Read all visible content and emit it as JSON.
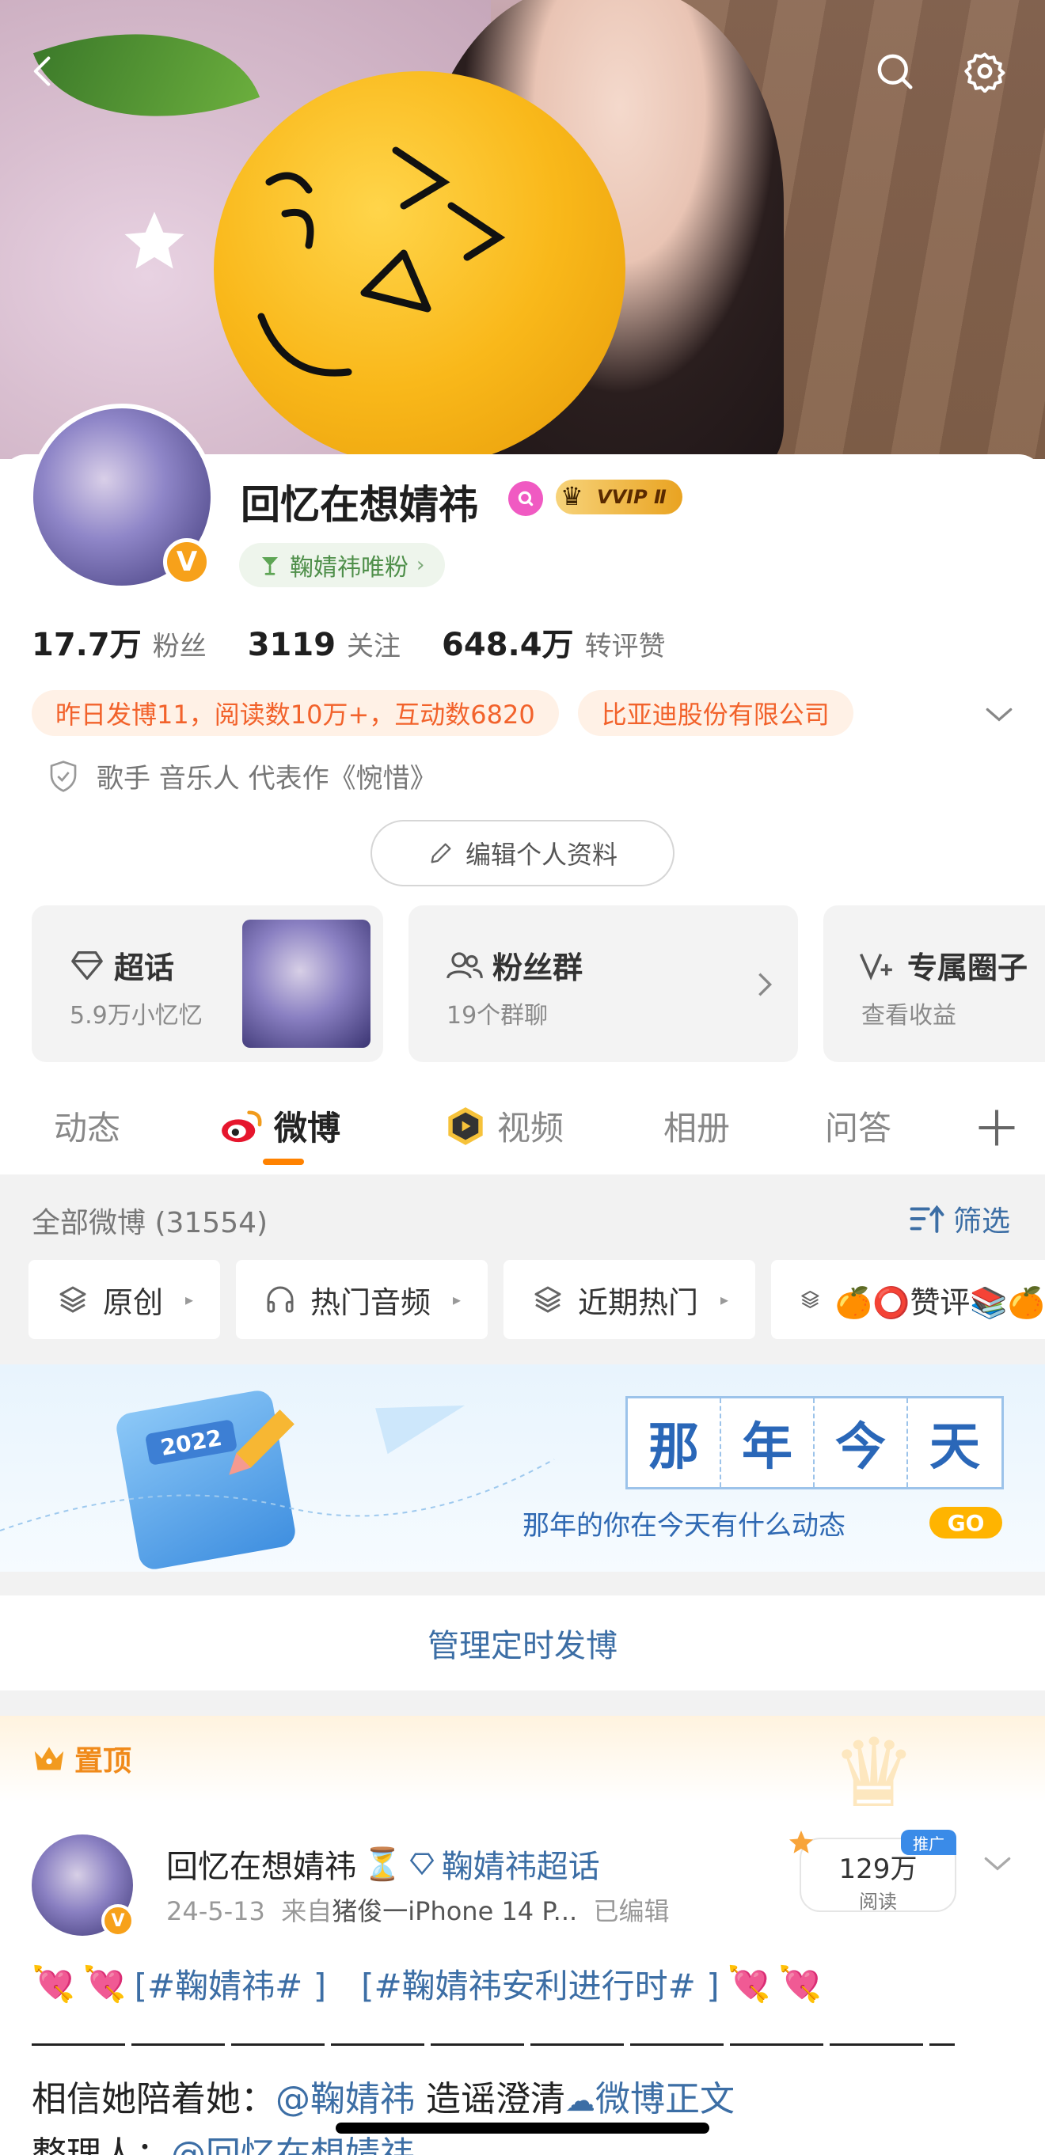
{
  "profile": {
    "name": "回忆在想婧祎",
    "vip_label": "VVIP Ⅱ",
    "fan_tag": "鞠婧祎唯粉",
    "verified_badge": "V",
    "stats": [
      {
        "value": "17.7万",
        "label": "粉丝"
      },
      {
        "value": "3119",
        "label": "关注"
      },
      {
        "value": "648.4万",
        "label": "转评赞"
      }
    ],
    "tags": [
      "昨日发博11，阅读数10万+，互动数6820",
      "比亚迪股份有限公司"
    ],
    "bio": "歌手 音乐人 代表作《惋惜》",
    "edit_label": "编辑个人资料"
  },
  "features": [
    {
      "title": "超话",
      "subtitle": "5.9万小忆忆",
      "icon": "diamond-icon"
    },
    {
      "title": "粉丝群",
      "subtitle": "19个群聊",
      "icon": "group-icon"
    },
    {
      "title": "专属圈子",
      "subtitle": "查看收益",
      "icon": "v-plus-icon"
    }
  ],
  "tabs": [
    "动态",
    "微博",
    "视频",
    "相册",
    "问答"
  ],
  "active_tab": "微博",
  "filter": {
    "all_label": "全部微博 (31554)",
    "screen_label": "筛选",
    "chips": [
      "原创",
      "热门音频",
      "近期热门",
      "🍊⭕赞评📚🍊"
    ]
  },
  "banner": {
    "title_chars": [
      "那",
      "年",
      "今",
      "天"
    ],
    "subtitle": "那年的你在今天有什么动态",
    "go": "GO",
    "calendar_year": "2022"
  },
  "scheduled_label": "管理定时发博",
  "pinned_label": "置顶",
  "post": {
    "author": "回忆在想婧祎",
    "hourglass": "⏳",
    "topic": "鞠婧祎超话",
    "date": "24-5-13",
    "source_prefix": "来自",
    "device": "猪俊一iPhone 14 P...",
    "edited": "已编辑",
    "reads": "129万",
    "reads_unit": "阅读",
    "promo": "推广",
    "hashtag1": "[#鞠婧祎# ]",
    "hashtag2": "[#鞠婧祎安利进行时# ]",
    "line2_prefix": "相信她陪着她：",
    "line2_mention": "@鞠婧祎",
    "line2_middle": " 造谣澄清",
    "line2_link": "微博正文",
    "line3_prefix": "整理人：",
    "line3_mention": "@回忆在想婧祎"
  },
  "colors": {
    "accent_orange": "#ff8200",
    "link_blue": "#3c6ea5",
    "tag_orange": "#f2622b"
  }
}
